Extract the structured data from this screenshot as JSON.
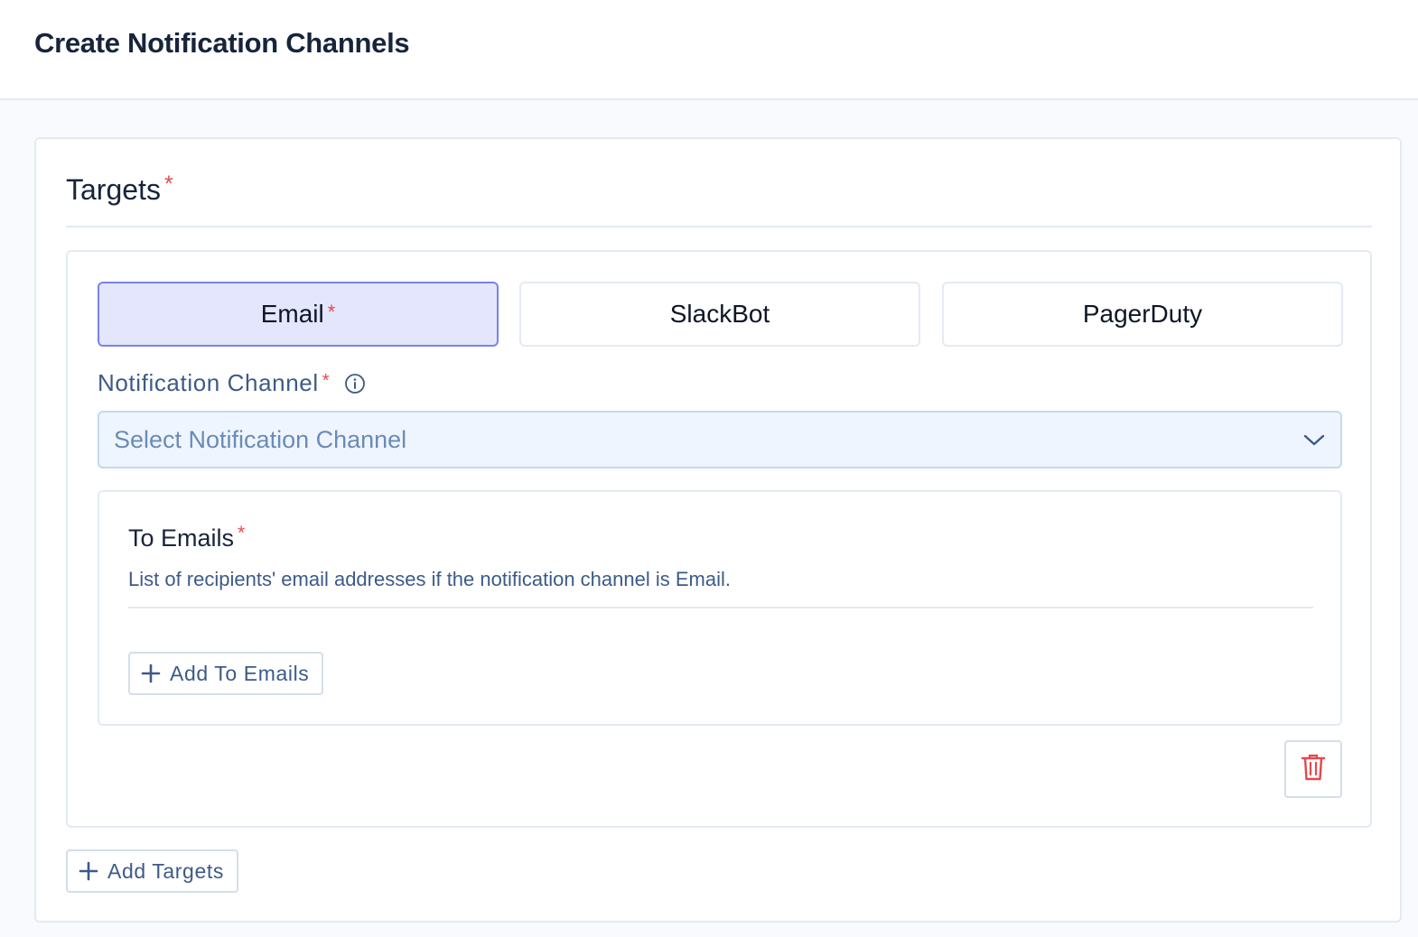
{
  "page": {
    "title": "Create Notification Channels"
  },
  "targets": {
    "title": "Targets",
    "required_mark": "*",
    "tabs": [
      {
        "label": "Email",
        "required_mark": "*",
        "active": true
      },
      {
        "label": "SlackBot",
        "active": false
      },
      {
        "label": "PagerDuty",
        "active": false
      }
    ],
    "notification_channel": {
      "label": "Notification Channel",
      "required_mark": "*",
      "placeholder": "Select Notification Channel"
    },
    "to_emails": {
      "title": "To Emails",
      "required_mark": "*",
      "description": "List of recipients' email addresses if the notification channel is Email.",
      "add_label": "Add To Emails"
    },
    "add_targets_label": "Add Targets"
  },
  "icons": {
    "info": "info-icon",
    "chevron": "chevron-down-icon",
    "plus": "plus-icon",
    "delete": "trash-icon"
  },
  "colors": {
    "accent_active_bg": "#e3e6fc",
    "accent_active_border": "#7a82e6",
    "required": "#e5484d",
    "delete": "#e5484d"
  }
}
